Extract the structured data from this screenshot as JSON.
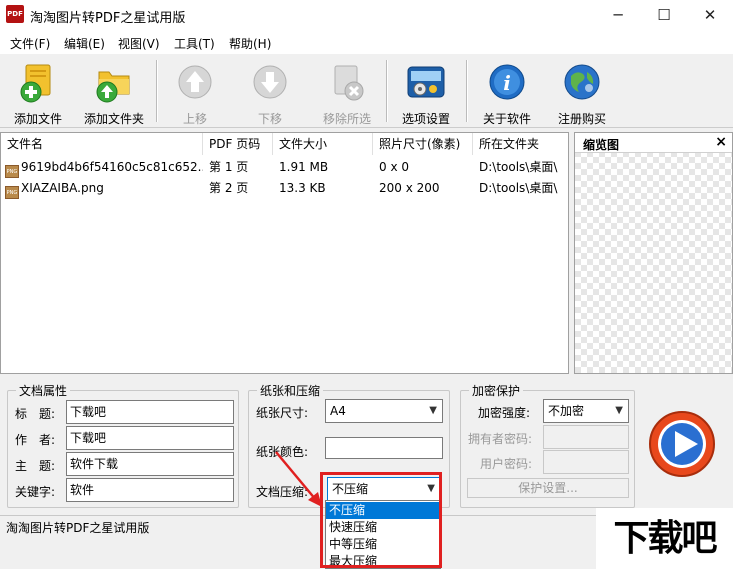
{
  "window": {
    "title": "淘淘图片转PDF之星试用版",
    "logo_text": "PDF"
  },
  "controls": {
    "minimize": "─",
    "maximize": "☐",
    "close": "✕"
  },
  "menu": [
    "文件(F)",
    "编辑(E)",
    "视图(V)",
    "工具(T)",
    "帮助(H)"
  ],
  "toolbar": {
    "add_file": "添加文件",
    "add_folder": "添加文件夹",
    "move_up": "上移",
    "move_down": "下移",
    "remove_selected": "移除所选",
    "options": "选项设置",
    "about": "关于软件",
    "register": "注册购买"
  },
  "file_table": {
    "headers": [
      "文件名",
      "PDF 页码",
      "文件大小",
      "照片尺寸(像素)",
      "所在文件夹"
    ],
    "rows": [
      {
        "name": "9619bd4b6f54160c5c81c652...",
        "page": "第 1 页",
        "size": "1.91 MB",
        "dims": "0 x 0",
        "folder": "D:\\tools\\桌面\\"
      },
      {
        "name": "XIAZAIBA.png",
        "page": "第 2 页",
        "size": "13.3 KB",
        "dims": "200 x 200",
        "folder": "D:\\tools\\桌面\\"
      }
    ],
    "file_icon_text": "PNG"
  },
  "thumbnail": {
    "title": "缩览图",
    "close": "×"
  },
  "doc_props": {
    "title": "文档属性",
    "title_label": "标　题:",
    "title_value": "下载吧",
    "author_label": "作　者:",
    "author_value": "下载吧",
    "subject_label": "主　题:",
    "subject_value": "软件下载",
    "keywords_label": "关键字:",
    "keywords_value": "软件"
  },
  "paper": {
    "title": "纸张和压缩",
    "size_label": "纸张尺寸:",
    "size_value": "A4",
    "color_label": "纸张颜色:",
    "compress_label": "文档压缩:",
    "compress_value": "不压缩",
    "compress_options": [
      "不压缩",
      "快速压缩",
      "中等压缩",
      "最大压缩"
    ]
  },
  "encrypt": {
    "title": "加密保护",
    "strength_label": "加密强度:",
    "strength_value": "不加密",
    "owner_label": "拥有者密码:",
    "user_label": "用户密码:",
    "settings_button": "保护设置..."
  },
  "status": {
    "text": "淘淘图片转PDF之星试用版"
  },
  "watermark": {
    "text": "下载吧"
  },
  "colors": {
    "accent": "#0078d7",
    "highlight": "#e02020",
    "run_button": "#e8481c"
  }
}
